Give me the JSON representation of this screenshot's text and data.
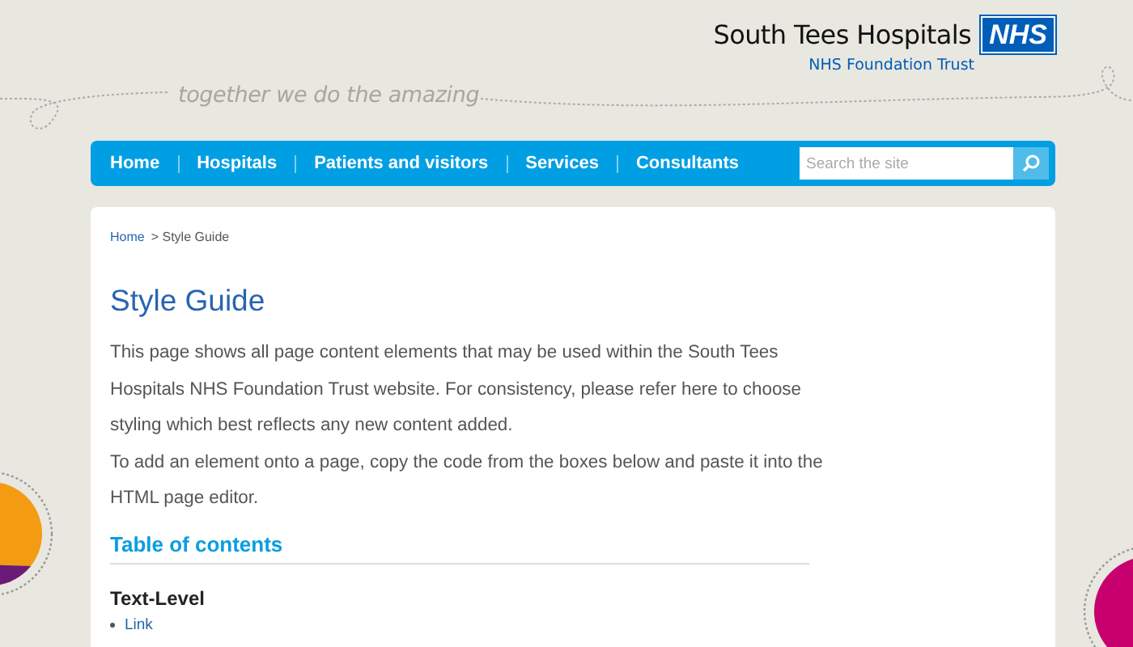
{
  "header": {
    "logo": {
      "name": "South Tees Hospitals",
      "badge": "NHS",
      "subtitle": "NHS Foundation Trust"
    },
    "tagline": "together we do the amazing"
  },
  "nav": {
    "items": [
      {
        "label": "Home"
      },
      {
        "label": "Hospitals"
      },
      {
        "label": "Patients and visitors"
      },
      {
        "label": "Services"
      },
      {
        "label": "Consultants"
      }
    ]
  },
  "search": {
    "placeholder": "Search the site"
  },
  "breadcrumb": [
    {
      "label": "Home",
      "kind": "link"
    },
    {
      "label": "> Style Guide",
      "kind": "current"
    }
  ],
  "content": {
    "title": "Style Guide",
    "paragraphs": [
      "This page shows all page content elements that may be used within the South Tees Hospitals NHS Foundation Trust website. For consistency, please refer here to choose styling which best reflects any new content added.",
      "To add an element onto a page, copy the code from the boxes below and paste it into the HTML page editor."
    ],
    "toc_heading": "Table of contents",
    "sections": [
      {
        "heading": "Text-Level",
        "items": [
          "Link"
        ]
      }
    ]
  }
}
